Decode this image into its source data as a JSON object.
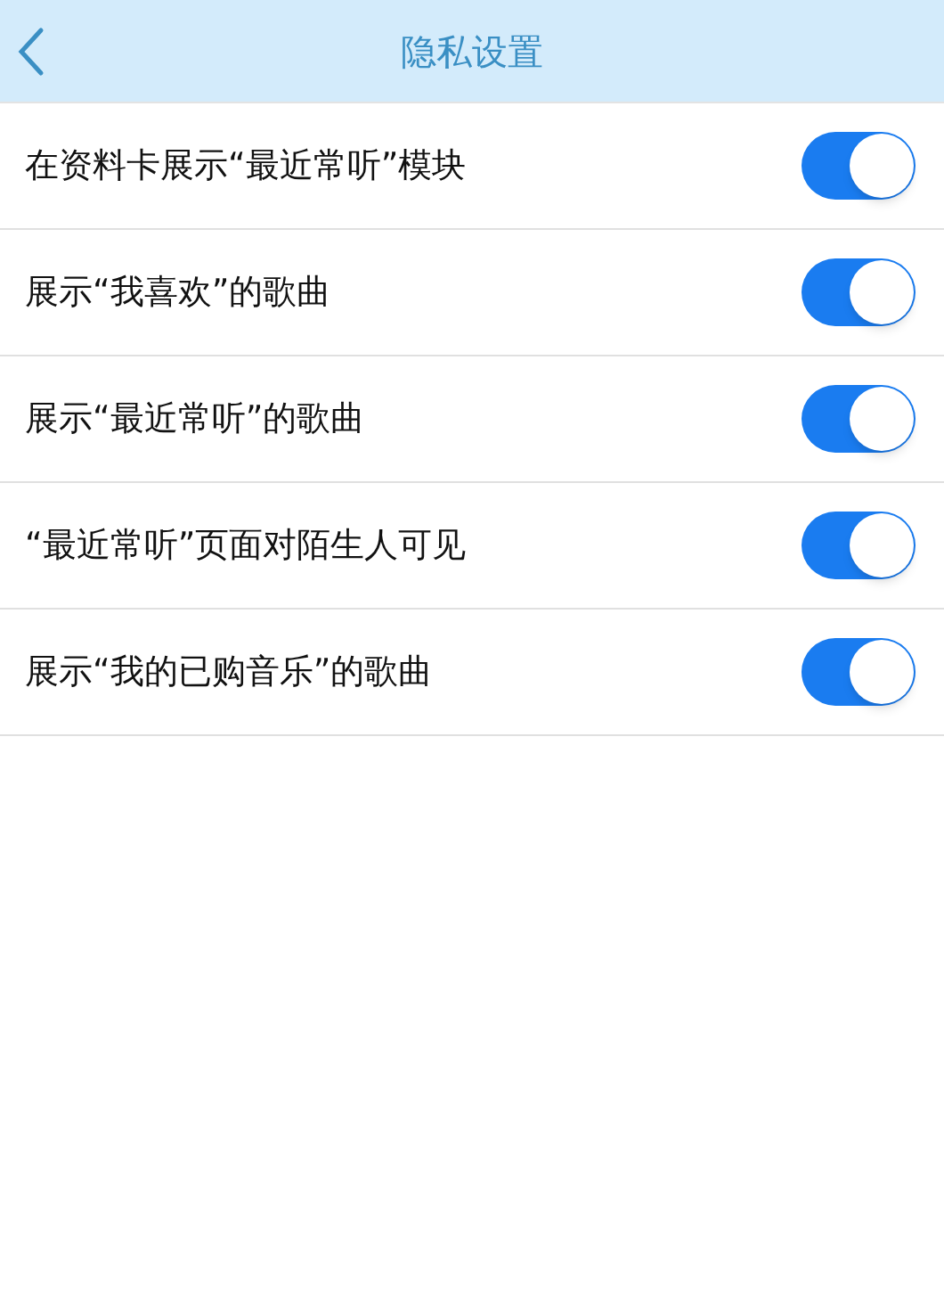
{
  "header": {
    "title": "隐私设置"
  },
  "settings": [
    {
      "label": "在资料卡展示“最近常听”模块",
      "on": true
    },
    {
      "label": "展示“我喜欢”的歌曲",
      "on": true
    },
    {
      "label": "展示“最近常听”的歌曲",
      "on": true
    },
    {
      "label": "“最近常听”页面对陌生人可见",
      "on": true
    },
    {
      "label": "展示“我的已购音乐”的歌曲",
      "on": true
    }
  ]
}
